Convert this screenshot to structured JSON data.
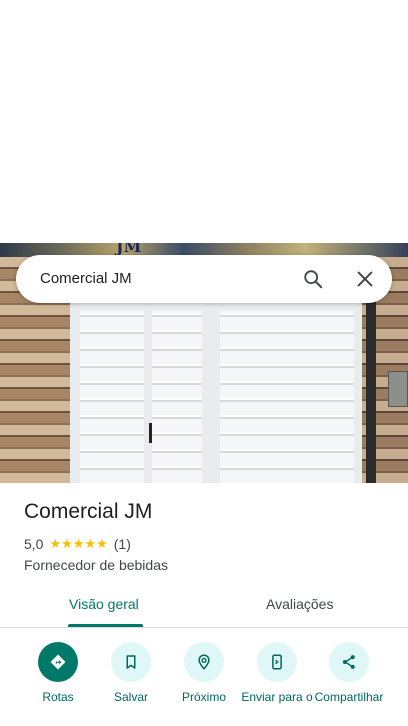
{
  "search": {
    "query": "Comercial JM"
  },
  "photo": {
    "sign_text": "JM"
  },
  "place": {
    "name": "Comercial JM",
    "rating": "5,0",
    "stars": "★★★★★",
    "review_count": "(1)",
    "category": "Fornecedor de bebidas"
  },
  "tabs": {
    "overview": "Visão geral",
    "reviews": "Avaliações"
  },
  "actions": {
    "directions": "Rotas",
    "save": "Salvar",
    "nearby": "Próximo",
    "send": "Enviar para o",
    "share": "Compartilhar"
  },
  "colors": {
    "accent": "#00796b",
    "star": "#fbbc04",
    "chip_bg": "#dff7f7"
  }
}
